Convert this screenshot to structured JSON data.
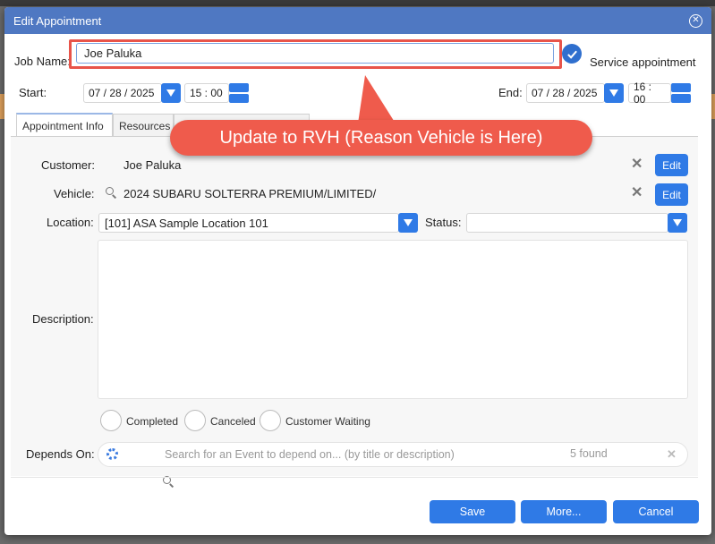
{
  "dialog": {
    "title": "Edit Appointment"
  },
  "job": {
    "label": "Job Name:",
    "value": "Joe Paluka",
    "service_label": "Service appointment"
  },
  "start": {
    "label": "Start:",
    "date": "07 / 28 / 2025",
    "time": "15 : 00"
  },
  "end": {
    "label": "End:",
    "date": "07 / 28 / 2025",
    "time": "16 : 00"
  },
  "tabs": [
    {
      "label": "Appointment Info"
    },
    {
      "label": "Resources"
    }
  ],
  "callout": {
    "text": "Update to RVH (Reason Vehicle is Here)"
  },
  "customer": {
    "label": "Customer:",
    "value": "Joe Paluka",
    "edit_label": "Edit"
  },
  "vehicle": {
    "label": "Vehicle:",
    "value": "2024 SUBARU SOLTERRA PREMIUM/LIMITED/",
    "edit_label": "Edit"
  },
  "location": {
    "label": "Location:",
    "value": "[101] ASA Sample Location 101"
  },
  "status": {
    "label": "Status:",
    "value": ""
  },
  "description": {
    "label": "Description:"
  },
  "flags": [
    {
      "label": "Completed"
    },
    {
      "label": "Canceled"
    },
    {
      "label": "Customer Waiting"
    }
  ],
  "depends": {
    "label": "Depends On:",
    "placeholder": "Search for an Event to depend on... (by title or description)",
    "count": "5 found"
  },
  "footer": {
    "save": "Save",
    "more": "More...",
    "cancel": "Cancel"
  },
  "colors": {
    "titlebar": "#4f78c2",
    "accent": "#2f7ae6",
    "callout": "#ef5b4c"
  }
}
